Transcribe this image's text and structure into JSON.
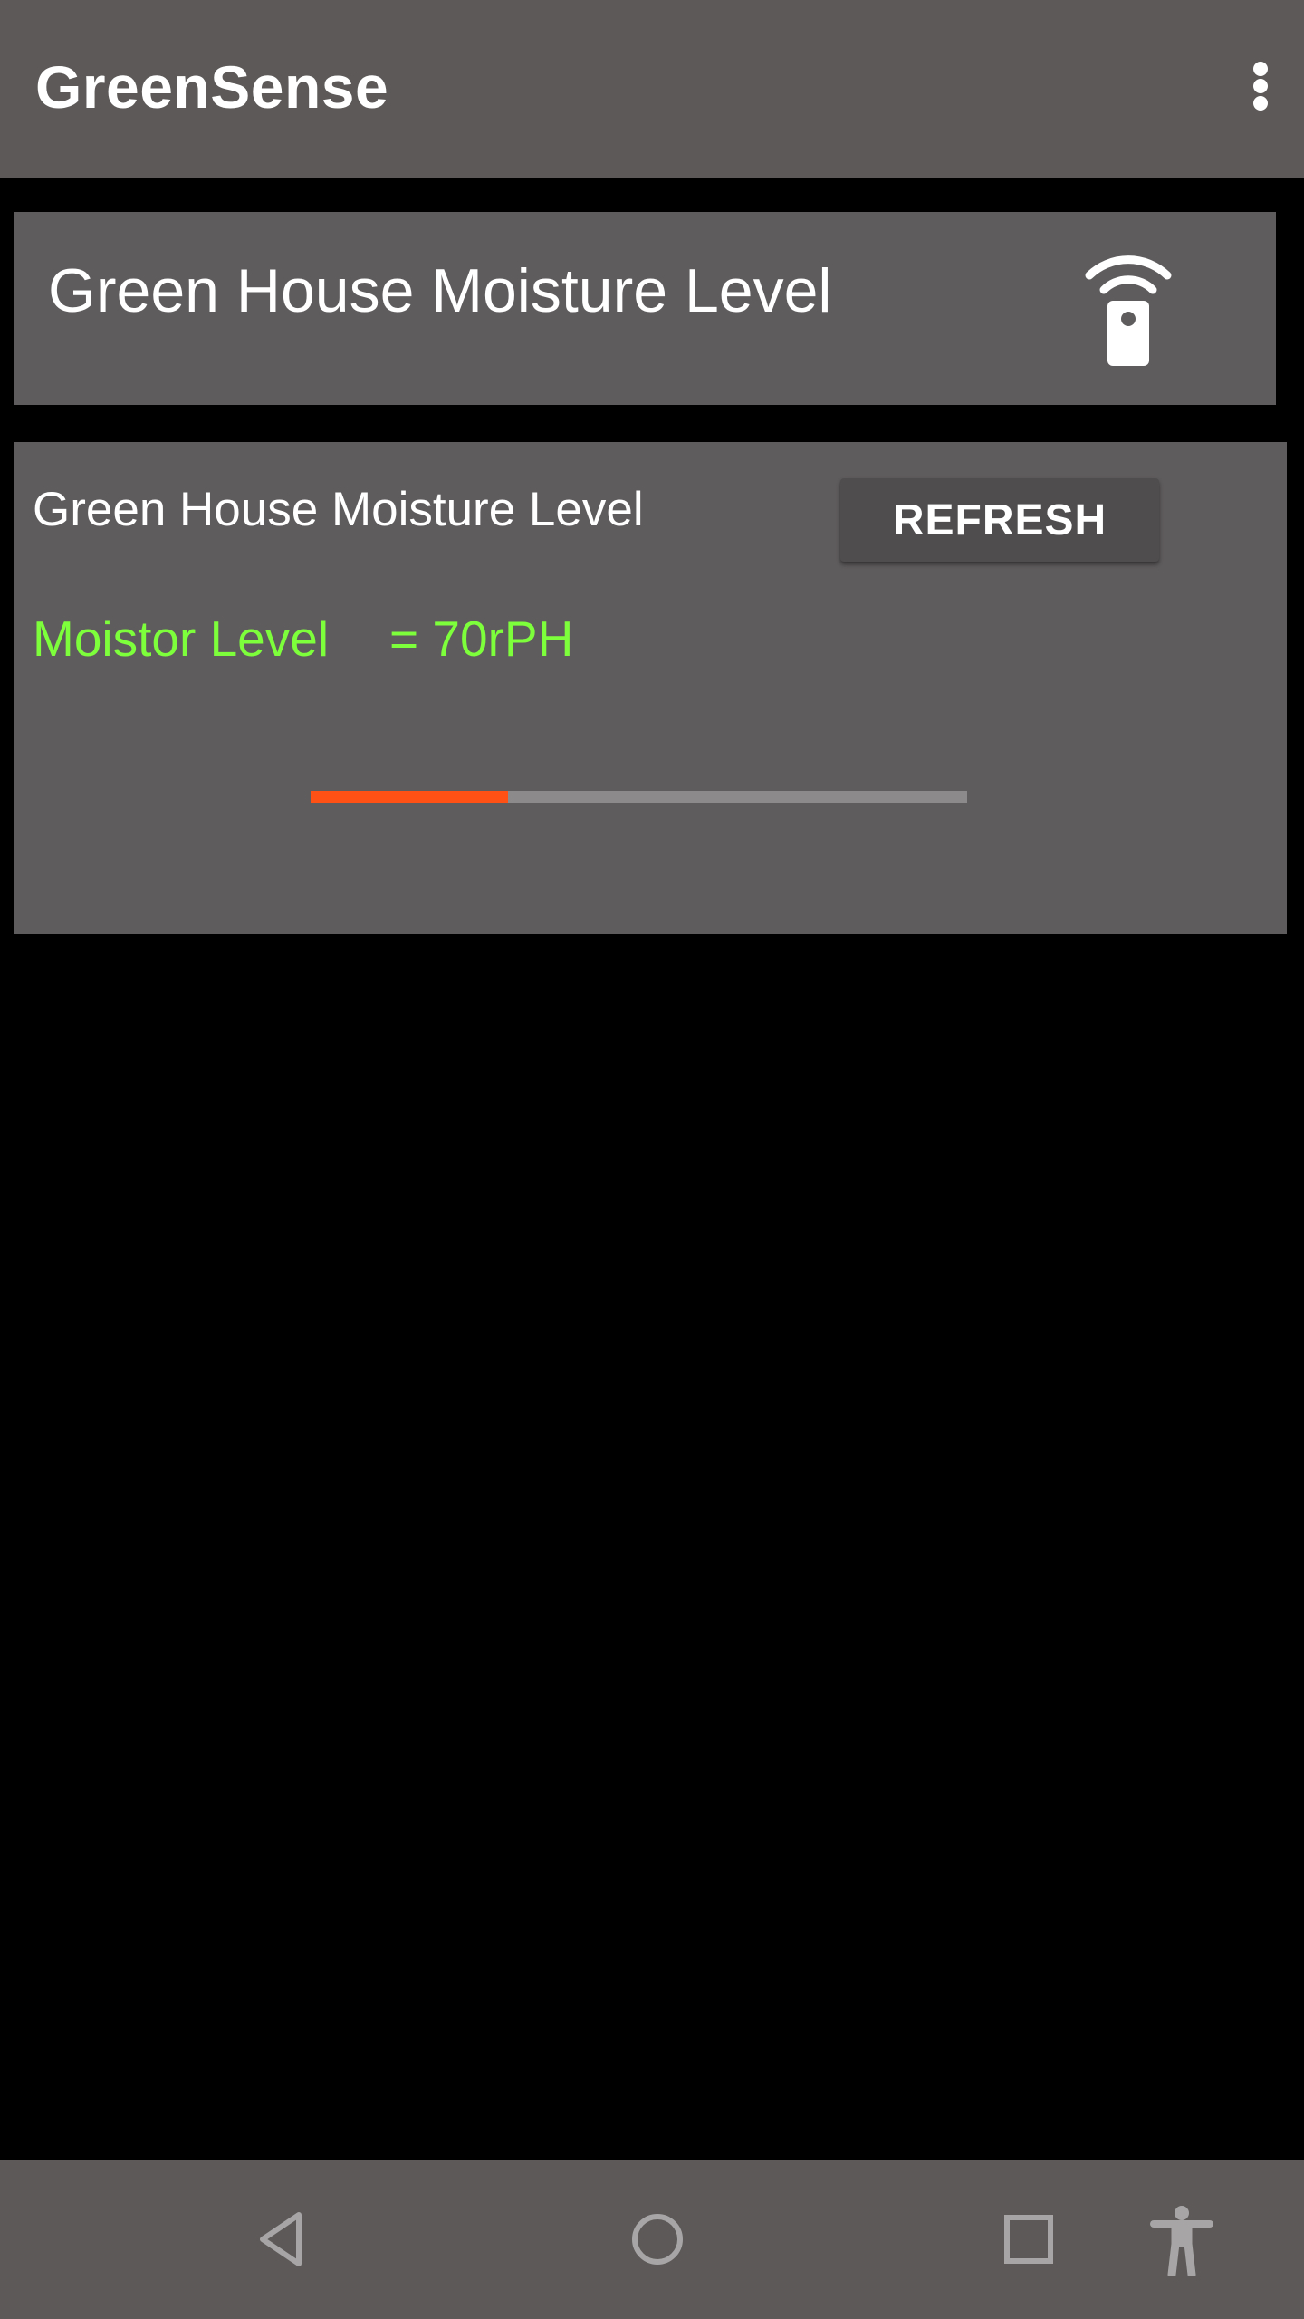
{
  "app_bar": {
    "title": "GreenSense",
    "overflow_icon": "more-vert-icon"
  },
  "header_card": {
    "title": "Green House Moisture Level",
    "icon": "remote-wifi-icon"
  },
  "reading_card": {
    "title": "Green House Moisture Level",
    "refresh_label": "REFRESH",
    "moisture_label": "Moistor Level",
    "moisture_value": "= 70rPH",
    "progress_fraction": 0.3,
    "progress_color": "#ff5115",
    "text_accent_color": "#7dff3b"
  },
  "nav_bar": {
    "icons": [
      "back-icon",
      "home-icon",
      "recents-icon",
      "accessibility-icon"
    ]
  }
}
